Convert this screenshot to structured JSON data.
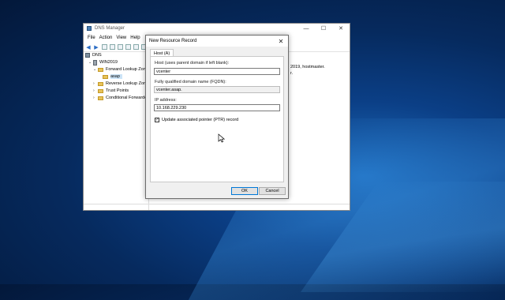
{
  "main_window": {
    "title": "DNS Manager",
    "controls": {
      "minimize": "—",
      "maximize": "☐",
      "close": "✕"
    },
    "menu": [
      "File",
      "Action",
      "View",
      "Help"
    ],
    "tree": {
      "root": "DNS",
      "server": "WIN2019",
      "forward_zones": "Forward Lookup Zones",
      "selected_zone": "asap",
      "reverse_zones": "Reverse Lookup Zones",
      "trust_points": "Trust Points",
      "conditional_forwarders": "Conditional Forwarders"
    },
    "right_pane": [
      "2019, hostmaster.",
      "r."
    ]
  },
  "dialog": {
    "title": "New Resource Record",
    "close": "✕",
    "tab": "Host (A)",
    "host_label": "Host (uses parent domain if left blank):",
    "host_value": "vcenter",
    "fqdn_label": "Fully qualified domain name (FQDN):",
    "fqdn_value": "vcenter.asap.",
    "ip_label": "IP address:",
    "ip_value": "10.168.229.230",
    "ptr_label": "Update associated pointer (PTR) record",
    "ptr_checked": "✓",
    "ok_label": "OK",
    "cancel_label": "Cancel"
  }
}
